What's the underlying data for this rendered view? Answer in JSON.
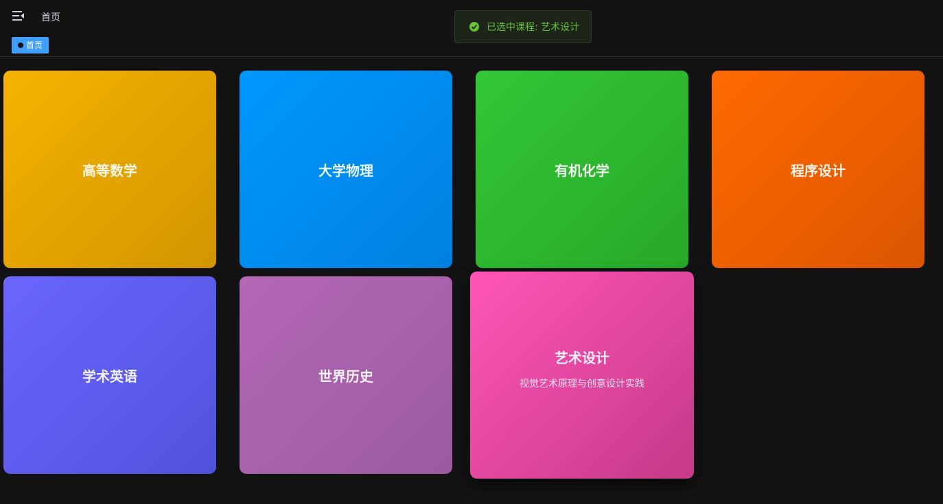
{
  "header": {
    "breadcrumb": "首页",
    "menu_icon": "menu-fold-icon"
  },
  "tags": [
    {
      "label": "首页",
      "active": true
    }
  ],
  "toast": {
    "message": "已选中课程: 艺术设计",
    "icon": "check-circle-icon",
    "color": "#67c23a"
  },
  "courses": [
    {
      "title": "高等数学",
      "color": "#f7b200"
    },
    {
      "title": "大学物理",
      "color": "#0098ff"
    },
    {
      "title": "有机化学",
      "color": "#33c736"
    },
    {
      "title": "程序设计",
      "color": "#ff6a00"
    },
    {
      "title": "学术英语",
      "color": "#6a66ff"
    },
    {
      "title": "世界历史",
      "color": "#b468b6"
    },
    {
      "title": "艺术设计",
      "subtitle": "视觉艺术原理与创意设计实践",
      "color": "#ff55b8",
      "hovered": true
    }
  ]
}
